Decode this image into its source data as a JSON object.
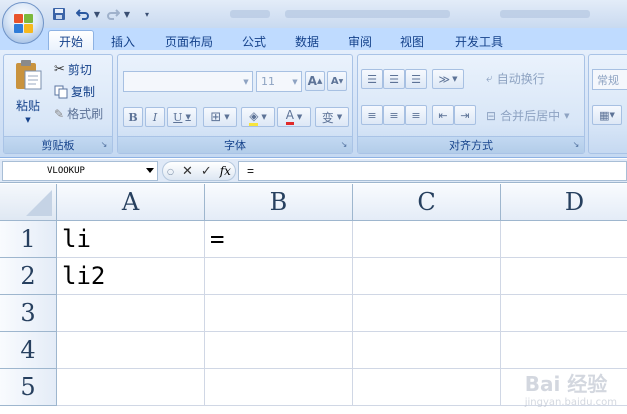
{
  "quick_access": {
    "save_icon": "save-icon",
    "undo_icon": "undo-icon",
    "redo_icon": "redo-icon"
  },
  "tabs": [
    {
      "label": "开始",
      "active": true
    },
    {
      "label": "插入",
      "active": false
    },
    {
      "label": "页面布局",
      "active": false
    },
    {
      "label": "公式",
      "active": false
    },
    {
      "label": "数据",
      "active": false
    },
    {
      "label": "审阅",
      "active": false
    },
    {
      "label": "视图",
      "active": false
    },
    {
      "label": "开发工具",
      "active": false
    }
  ],
  "clipboard": {
    "paste": "粘贴",
    "cut": "剪切",
    "copy": "复制",
    "format_painter": "格式刷",
    "group_label": "剪贴板"
  },
  "font": {
    "font_name": "",
    "font_size": "11",
    "grow_font": "A",
    "shrink_font": "A",
    "bold": "B",
    "italic": "I",
    "underline": "U",
    "font_color_letter": "A",
    "phonetic": "变",
    "group_label": "字体"
  },
  "alignment": {
    "wrap_text": "自动换行",
    "merge_center": "合并后居中",
    "group_label": "对齐方式"
  },
  "number": {
    "format": "常规"
  },
  "formula_bar": {
    "name_box": "VLOOKUP",
    "cancel": "✕",
    "enter": "✓",
    "fx": "fx",
    "content": "="
  },
  "sheet": {
    "columns": [
      "A",
      "B",
      "C",
      "D"
    ],
    "rows": [
      "1",
      "2",
      "3",
      "4",
      "5"
    ],
    "cells": {
      "A1": "li",
      "B1": "=",
      "A2": "li2"
    }
  },
  "watermark": {
    "brand": "Bai 经验",
    "url": "jingyan.baidu.com"
  },
  "colors": {
    "ribbon_bg": "#d3e2f6",
    "tab_text": "#15428b",
    "grid_line": "#d0d7e5",
    "header_border": "#9eb6ce"
  }
}
